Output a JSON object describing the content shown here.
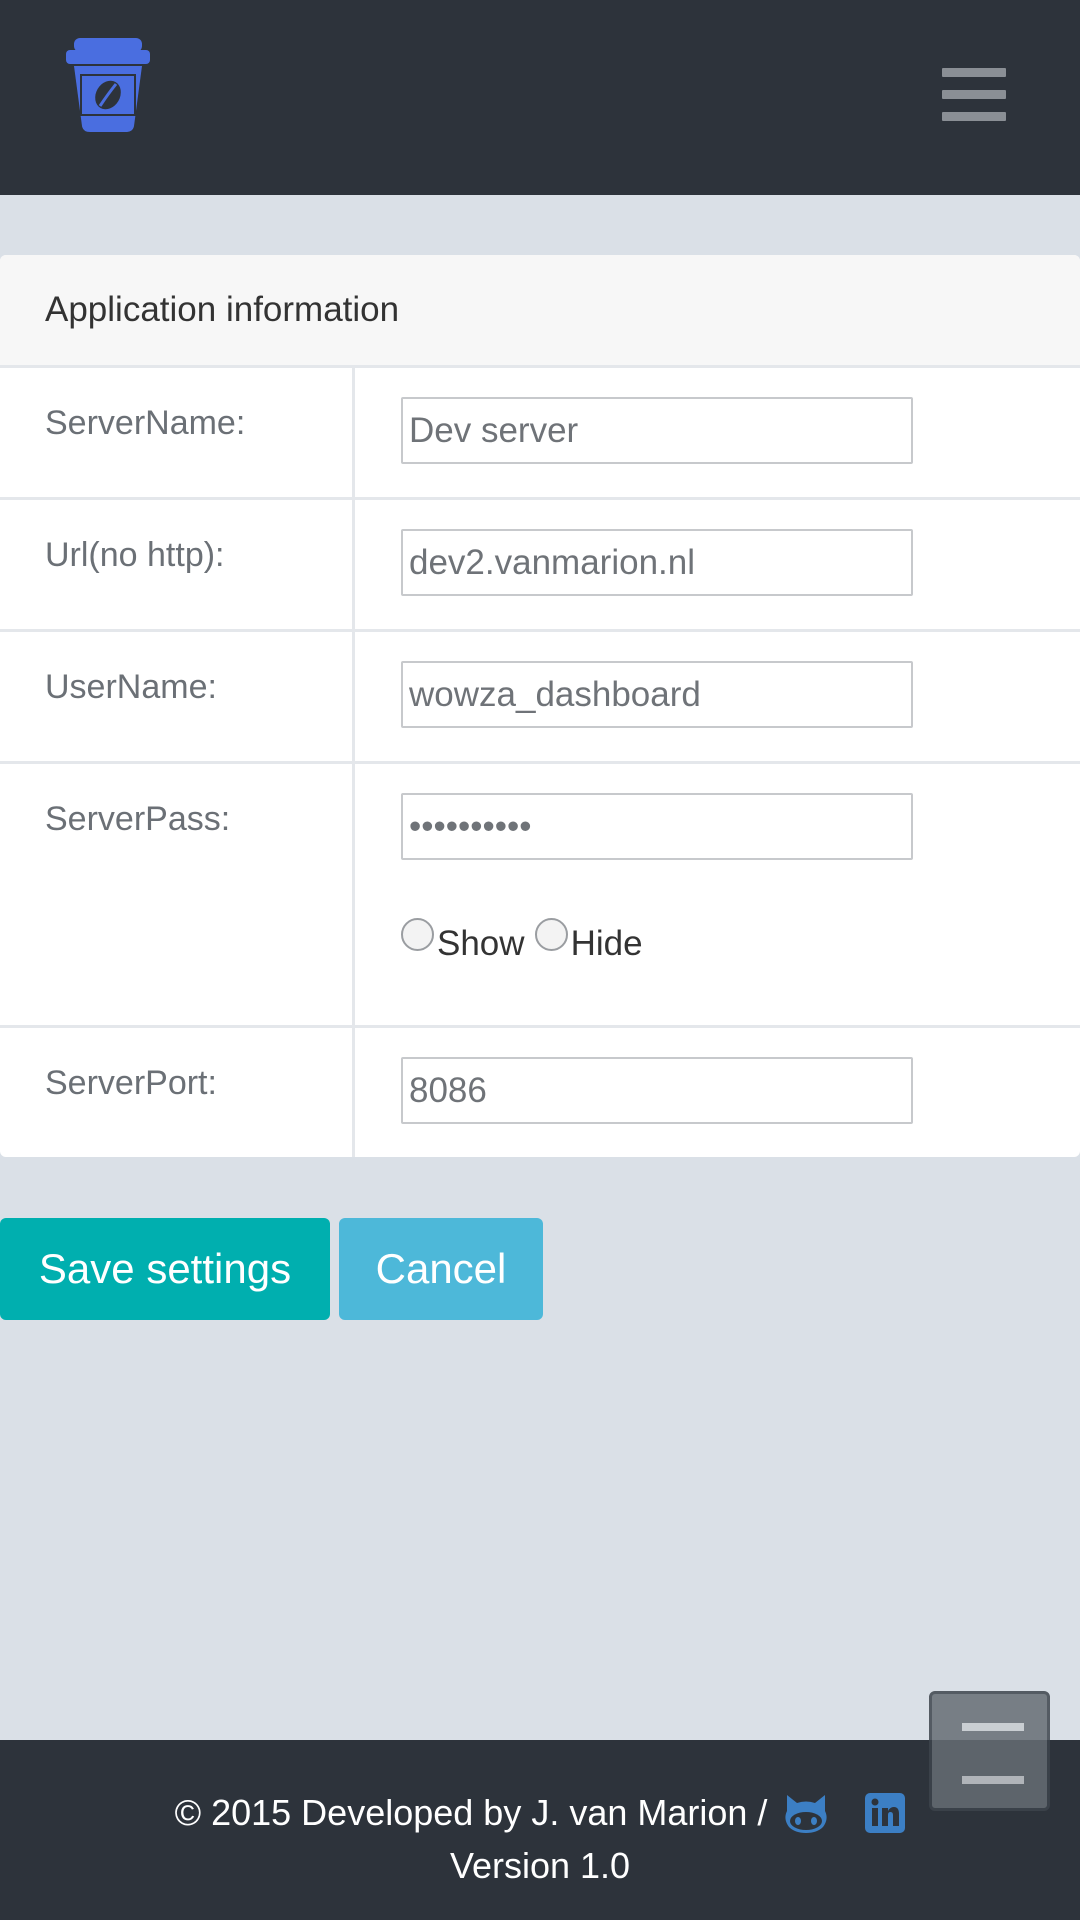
{
  "header": {
    "logo_icon": "coffee-cup-icon",
    "menu_icon": "hamburger-menu-icon",
    "colors": {
      "background": "#2d333b",
      "logo": "#4a6ee0"
    }
  },
  "panel": {
    "title": "Application information",
    "fields": [
      {
        "label": "ServerName:",
        "value": "Dev server",
        "type": "text"
      },
      {
        "label": "Url(no http):",
        "value": "dev2.vanmarion.nl",
        "type": "text"
      },
      {
        "label": "UserName:",
        "value": "wowza_dashboard",
        "type": "text"
      },
      {
        "label": "ServerPass:",
        "value": "••••••••••",
        "type": "password"
      },
      {
        "label": "ServerPort:",
        "value": "8086",
        "type": "text"
      }
    ],
    "password_toggle": {
      "show_label": "Show",
      "hide_label": "Hide"
    }
  },
  "actions": {
    "save_label": "Save settings",
    "cancel_label": "Cancel",
    "colors": {
      "save": "#00afaf",
      "cancel": "#4db8d9"
    }
  },
  "footer": {
    "line1": "© 2015 Developed by J. van Marion /",
    "line2": "Version 1.0",
    "icons": [
      "github-icon",
      "linkedin-icon"
    ]
  },
  "scroll_top_icon": "scroll-top-icon"
}
